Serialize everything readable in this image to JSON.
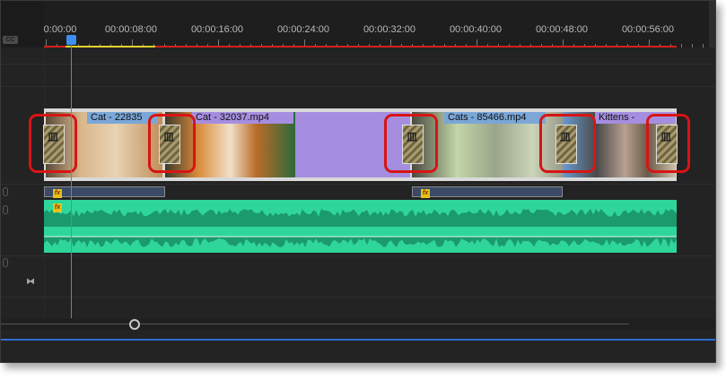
{
  "ruler": {
    "ticks": [
      "0:00:00",
      "00:00:08:00",
      "00:00:16:00",
      "00:00:24:00",
      "00:00:32:00",
      "00:00:40:00",
      "00:00:48:00",
      "00:00:56:00"
    ],
    "cc_label": "CC"
  },
  "clips": [
    {
      "label": "Cat - 22835",
      "color": "#7aa6d8"
    },
    {
      "label": "Cat - 32037.mp4",
      "color": "#a58ee0"
    },
    {
      "label": "Cats - 85466.mp4",
      "color": "#7aa6d8"
    },
    {
      "label": "Kittens - ",
      "color": "#a58ee0"
    }
  ],
  "fx_label": "fx",
  "transition_glyph": "皿",
  "playhead_time": "00:00:01:12",
  "colors": {
    "highlight": "#d81414",
    "audio": "#2fd69a",
    "playhead": "#3b8ff0",
    "in_out_line": "#d42020"
  }
}
